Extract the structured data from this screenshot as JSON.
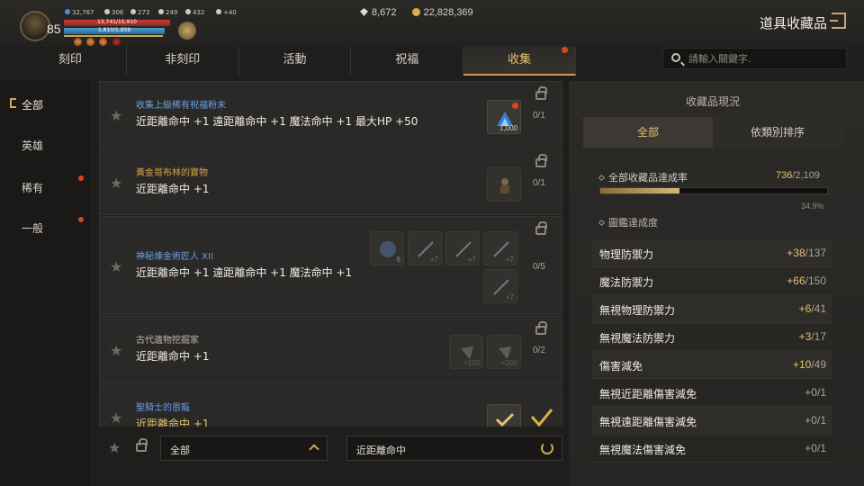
{
  "player": {
    "level": "85",
    "stats": [
      "32,767",
      "306",
      "273",
      "249",
      "432",
      "+40"
    ],
    "hp": "13,741/15,910",
    "mp": "1,810/1,859"
  },
  "currency": {
    "gems": "8,672",
    "gold": "22,828,369"
  },
  "page_title": "道具收藏品",
  "tabs": [
    {
      "label": "刻印"
    },
    {
      "label": "非刻印"
    },
    {
      "label": "活動"
    },
    {
      "label": "祝福"
    },
    {
      "label": "收集"
    }
  ],
  "search": {
    "placeholder": "請輸入關鍵字."
  },
  "filters": [
    "全部",
    "英雄",
    "稀有",
    "一般"
  ],
  "collections": [
    {
      "category": "收集上級稀有祝福粉末",
      "category_color": "#6aa0e8",
      "effect": "近距離命中 +1 遠距離命中 +1 魔法命中 +1 最大HP +50",
      "progress": "0/1",
      "items": [
        {
          "qty": "1,000",
          "icon": "blue-powder-icon"
        }
      ]
    },
    {
      "category": "黃金哥布林的寶物",
      "category_color": "#d9a24a",
      "effect": "近距離命中 +1",
      "progress": "0/1",
      "items": [
        {
          "qty": "",
          "icon": "treasure-idol-icon"
        }
      ]
    },
    {
      "category": "神秘煉金術匠人 XII",
      "category_color": "#6aa0e8",
      "effect": "近距離命中 +1 遠距離命中 +1 魔法命中 +1",
      "progress": "0/5",
      "items": [
        {
          "qty": "6",
          "icon": "orb-icon"
        },
        {
          "qty": "+7",
          "icon": "sword-icon"
        },
        {
          "qty": "+7",
          "icon": "sword-icon"
        },
        {
          "qty": "+7",
          "icon": "sword-icon"
        },
        {
          "qty": "+7",
          "icon": "sword-icon"
        }
      ]
    },
    {
      "category": "古代遺物挖掘家",
      "category_color": "#bdb7ab",
      "effect": "近距離命中 +1",
      "progress": "0/2",
      "items": [
        {
          "qty": "×100",
          "icon": "relic-shard-icon"
        },
        {
          "qty": "×200",
          "icon": "relic-shard-icon"
        }
      ]
    },
    {
      "category": "聖騎士的恩寵",
      "category_color": "#6aa0e8",
      "effect": "近距離命中 +1",
      "progress": "",
      "items": [
        {
          "qty": "",
          "icon": "blessing-icon"
        }
      ]
    }
  ],
  "bottom": {
    "filter_value": "全部",
    "sort_value": "近距離命中"
  },
  "panel": {
    "title": "收藏品現況",
    "tabs": [
      "全部",
      "依類別排序"
    ],
    "completion_label": "全部收藏品達成率",
    "completion_current": "736",
    "completion_total": "/2,109",
    "completion_pct": "34.9%",
    "completion_fraction": 0.349,
    "codex_label": "圖鑑達成度",
    "stats": [
      {
        "name": "物理防禦力",
        "bonus": "+38",
        "total": "/137"
      },
      {
        "name": "魔法防禦力",
        "bonus": "+66",
        "total": "/150"
      },
      {
        "name": "無視物理防禦力",
        "bonus": "+6",
        "total": "/41"
      },
      {
        "name": "無視魔法防禦力",
        "bonus": "+3",
        "total": "/17"
      },
      {
        "name": "傷害減免",
        "bonus": "+10",
        "total": "/49"
      },
      {
        "name": "無視近距離傷害減免",
        "bonus": "",
        "total": "+0/1"
      },
      {
        "name": "無視遠距離傷害減免",
        "bonus": "",
        "total": "+0/1"
      },
      {
        "name": "無視魔法傷害減免",
        "bonus": "",
        "total": "+0/1"
      }
    ]
  }
}
